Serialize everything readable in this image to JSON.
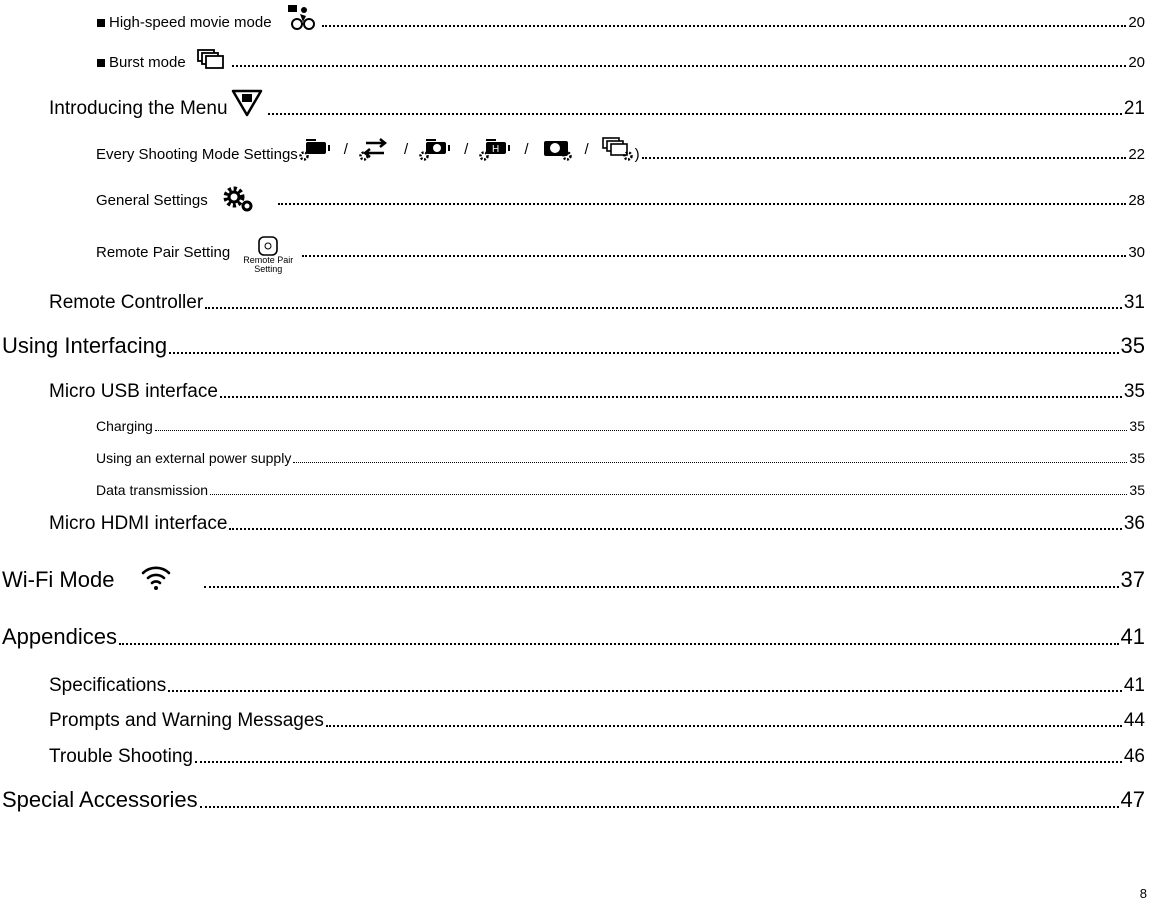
{
  "toc": [
    {
      "title": "High-speed movie mode",
      "page": "20",
      "icon": "high-speed-movie-icon"
    },
    {
      "title": "Burst mode",
      "page": "20",
      "icon": "burst-icon"
    },
    {
      "title": "Introducing the Menu",
      "page": "21",
      "icon": "menu-icon"
    },
    {
      "title": "Every Shooting Mode Settings",
      "page": "22",
      "icons": [
        "video-settings-icon",
        "loop-settings-icon",
        "timelapse-settings-icon",
        "hdr-video-settings-icon",
        "photo-settings-icon",
        "burst-settings-icon"
      ],
      "separator": "/",
      "close": ")"
    },
    {
      "title": "General Settings",
      "page": "28",
      "icon": "gear-icon"
    },
    {
      "title": "Remote Pair Setting",
      "page": "30",
      "icon": "remote-pair-icon",
      "icon_label": "Remote Pair Setting"
    },
    {
      "title": "Remote Controller",
      "page": "31"
    },
    {
      "title": "Using Interfacing",
      "page": "35"
    },
    {
      "title": "Micro USB interface",
      "page": "35"
    },
    {
      "title": "Charging",
      "page": "35"
    },
    {
      "title": "Using an external power supply",
      "page": "35"
    },
    {
      "title": "Data transmission",
      "page": "35"
    },
    {
      "title": "Micro HDMI interface",
      "page": "36"
    },
    {
      "title": "Wi-Fi Mode",
      "page": "37",
      "icon": "wifi-icon"
    },
    {
      "title": "Appendices",
      "page": "41"
    },
    {
      "title": "Specifications",
      "page": "41"
    },
    {
      "title": "Prompts and Warning Messages",
      "page": "44"
    },
    {
      "title": "Trouble Shooting",
      "page": "46"
    },
    {
      "title": "Special Accessories",
      "page": "47"
    }
  ],
  "page_number": "8"
}
